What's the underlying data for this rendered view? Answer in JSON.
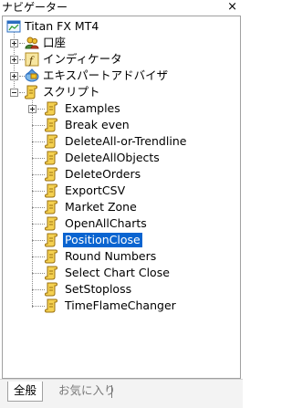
{
  "window": {
    "title": "ナビゲーター",
    "close_label": "×"
  },
  "tree": {
    "root": {
      "label": "Titan FX MT4",
      "icon": "terminal-icon"
    },
    "nodes": [
      {
        "label": "口座",
        "icon": "accounts-icon",
        "state": "collapsed"
      },
      {
        "label": "インディケータ",
        "icon": "indicators-icon",
        "state": "collapsed"
      },
      {
        "label": "エキスパートアドバイザ",
        "icon": "expert-advisors-icon",
        "state": "collapsed"
      },
      {
        "label": "スクリプト",
        "icon": "scripts-icon",
        "state": "expanded"
      }
    ],
    "scripts": [
      {
        "label": "Examples",
        "expandable": true
      },
      {
        "label": "Break even"
      },
      {
        "label": "DeleteAll-or-Trendline"
      },
      {
        "label": "DeleteAllObjects"
      },
      {
        "label": "DeleteOrders"
      },
      {
        "label": "ExportCSV"
      },
      {
        "label": "Market Zone"
      },
      {
        "label": "OpenAllCharts"
      },
      {
        "label": "PositionClose",
        "selected": true
      },
      {
        "label": "Round Numbers"
      },
      {
        "label": "Select Chart Close"
      },
      {
        "label": "SetStoploss"
      },
      {
        "label": "TimeFlameChanger"
      }
    ]
  },
  "tabs": {
    "all": "全般",
    "favorites": "お気に入り"
  },
  "colors": {
    "selection": "#0a64d0",
    "script_icon": "#f0c020",
    "border": "#a0a0a0"
  }
}
